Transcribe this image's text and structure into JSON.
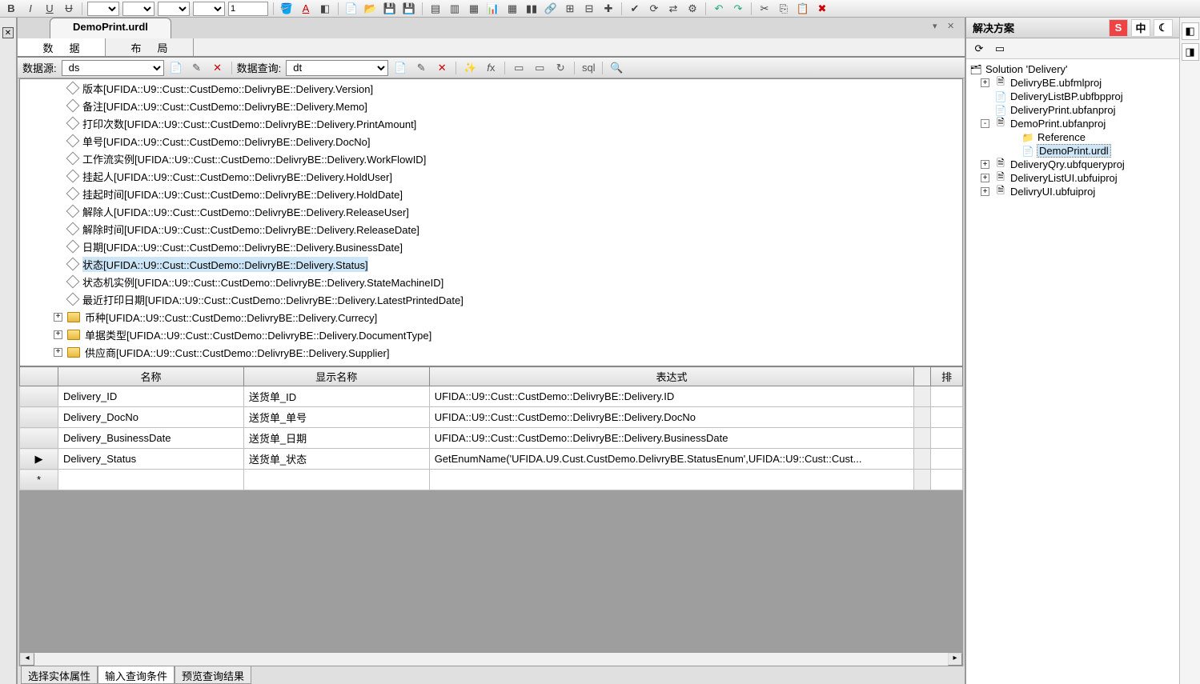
{
  "doc_tab": "DemoPrint.urdl",
  "inner_tabs": {
    "data": "数据",
    "layout": "布局"
  },
  "ds_bar": {
    "ds_label": "数据源:",
    "ds_value": "ds",
    "dq_label": "数据查询:",
    "dq_value": "dt"
  },
  "tree": [
    {
      "kind": "leaf",
      "label": "版本[UFIDA::U9::Cust::CustDemo::DelivryBE::Delivery.Version]"
    },
    {
      "kind": "leaf",
      "label": "备注[UFIDA::U9::Cust::CustDemo::DelivryBE::Delivery.Memo]"
    },
    {
      "kind": "leaf",
      "label": "打印次数[UFIDA::U9::Cust::CustDemo::DelivryBE::Delivery.PrintAmount]"
    },
    {
      "kind": "leaf",
      "label": "单号[UFIDA::U9::Cust::CustDemo::DelivryBE::Delivery.DocNo]"
    },
    {
      "kind": "leaf",
      "label": "工作流实例[UFIDA::U9::Cust::CustDemo::DelivryBE::Delivery.WorkFlowID]"
    },
    {
      "kind": "leaf",
      "label": "挂起人[UFIDA::U9::Cust::CustDemo::DelivryBE::Delivery.HoldUser]"
    },
    {
      "kind": "leaf",
      "label": "挂起时间[UFIDA::U9::Cust::CustDemo::DelivryBE::Delivery.HoldDate]"
    },
    {
      "kind": "leaf",
      "label": "解除人[UFIDA::U9::Cust::CustDemo::DelivryBE::Delivery.ReleaseUser]"
    },
    {
      "kind": "leaf",
      "label": "解除时间[UFIDA::U9::Cust::CustDemo::DelivryBE::Delivery.ReleaseDate]"
    },
    {
      "kind": "leaf",
      "label": "日期[UFIDA::U9::Cust::CustDemo::DelivryBE::Delivery.BusinessDate]"
    },
    {
      "kind": "leaf",
      "label": "状态[UFIDA::U9::Cust::CustDemo::DelivryBE::Delivery.Status]",
      "selected": true
    },
    {
      "kind": "leaf",
      "label": "状态机实例[UFIDA::U9::Cust::CustDemo::DelivryBE::Delivery.StateMachineID]"
    },
    {
      "kind": "leaf",
      "label": "最近打印日期[UFIDA::U9::Cust::CustDemo::DelivryBE::Delivery.LatestPrintedDate]"
    },
    {
      "kind": "folder",
      "label": "币种[UFIDA::U9::Cust::CustDemo::DelivryBE::Delivery.Currecy]"
    },
    {
      "kind": "folder",
      "label": "单据类型[UFIDA::U9::Cust::CustDemo::DelivryBE::Delivery.DocumentType]"
    },
    {
      "kind": "folder",
      "label": "供应商[UFIDA::U9::Cust::CustDemo::DelivryBE::Delivery.Supplier]"
    }
  ],
  "grid": {
    "headers": {
      "name": "名称",
      "disp": "显示名称",
      "expr": "表达式",
      "sort": "排"
    },
    "rows": [
      {
        "name": "Delivery_ID",
        "disp": "送货单_ID",
        "expr": "UFIDA::U9::Cust::CustDemo::DelivryBE::Delivery.ID"
      },
      {
        "name": "Delivery_DocNo",
        "disp": "送货单_单号",
        "expr": "UFIDA::U9::Cust::CustDemo::DelivryBE::Delivery.DocNo"
      },
      {
        "name": "Delivery_BusinessDate",
        "disp": "送货单_日期",
        "expr": "UFIDA::U9::Cust::CustDemo::DelivryBE::Delivery.BusinessDate"
      },
      {
        "name": "Delivery_Status",
        "disp": "送货单_状态",
        "expr": "GetEnumName('UFIDA.U9.Cust.CustDemo.DelivryBE.StatusEnum',UFIDA::U9::Cust::Cust...",
        "current": true
      }
    ]
  },
  "bottom_tabs": {
    "t1": "选择实体属性",
    "t2": "输入查询条件",
    "t3": "预览查询结果"
  },
  "right": {
    "title": "解决方案",
    "solution": "Solution 'Delivery'",
    "nodes": [
      {
        "depth": 0,
        "exp": "+",
        "ico": "proj",
        "label": "DelivryBE.ubfmlproj"
      },
      {
        "depth": 0,
        "exp": "",
        "ico": "file",
        "label": "DeliveryListBP.ubfbpproj"
      },
      {
        "depth": 0,
        "exp": "",
        "ico": "file",
        "label": "DeliveryPrint.ubfanproj"
      },
      {
        "depth": 0,
        "exp": "-",
        "ico": "proj",
        "label": "DemoPrint.ubfanproj"
      },
      {
        "depth": 1,
        "exp": "",
        "ico": "ref",
        "label": "Reference"
      },
      {
        "depth": 1,
        "exp": "",
        "ico": "doc",
        "label": "DemoPrint.urdl",
        "selected": true
      },
      {
        "depth": 0,
        "exp": "+",
        "ico": "proj",
        "label": "DeliveryQry.ubfqueryproj"
      },
      {
        "depth": 0,
        "exp": "+",
        "ico": "proj",
        "label": "DeliveryListUI.ubfuiproj"
      },
      {
        "depth": 0,
        "exp": "+",
        "ico": "proj",
        "label": "DelivryUI.ubfuiproj"
      }
    ]
  }
}
